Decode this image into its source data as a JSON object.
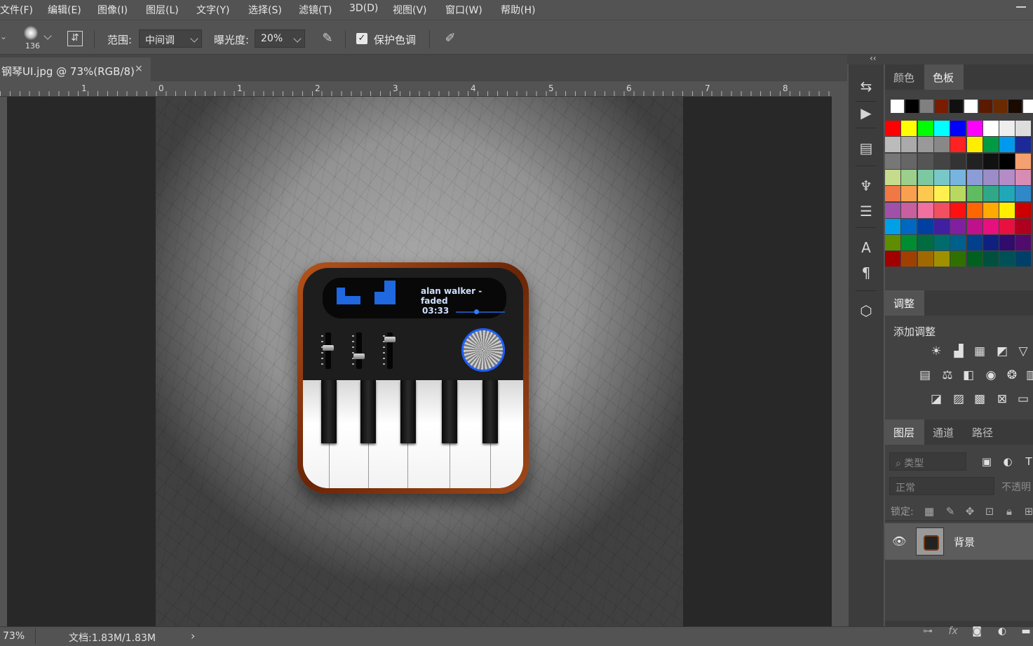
{
  "menu": {
    "items": [
      "文件(F)",
      "编辑(E)",
      "图像(I)",
      "图层(L)",
      "文字(Y)",
      "选择(S)",
      "滤镜(T)",
      "3D(D)",
      "视图(V)",
      "窗口(W)",
      "帮助(H)"
    ]
  },
  "options": {
    "brush_size": "136",
    "range_label": "范围:",
    "range_value": "中间调",
    "exposure_label": "曝光度:",
    "exposure_value": "20%",
    "protect_tones_label": "保护色调",
    "protect_tones_checked": true
  },
  "document": {
    "tab_title": "钢琴UI.jpg @ 73%(RGB/8)",
    "close_glyph": "×"
  },
  "ruler": {
    "labels": [
      "1",
      "0",
      "1",
      "2",
      "3",
      "4",
      "5",
      "6",
      "7",
      "8"
    ]
  },
  "canvas": {
    "track_title": "alan walker - faded",
    "track_time": "03:33"
  },
  "status": {
    "zoom": "73%",
    "doc_size": "文档:1.83M/1.83M",
    "arrow": "›"
  },
  "panels": {
    "collapse_glyph": "‹‹",
    "color_tabs": [
      "颜色",
      "色板"
    ],
    "active_color_tab": "色板",
    "adjustments_tab": "调整",
    "add_adjustment_label": "添加调整",
    "layer_tabs": [
      "图层",
      "通道",
      "路径"
    ],
    "filter_placeholder": "类型",
    "blend_mode": "正常",
    "opacity_label": "不透明",
    "lock_label": "锁定:",
    "layer_name": "背景",
    "footer_icons": [
      "link-icon",
      "fx-icon",
      "mask-icon",
      "adjustment-layer-icon",
      "folder-icon"
    ]
  },
  "swatches": {
    "rows": [
      [
        "#ffffff",
        "#000000",
        "#808080",
        "#7a1c00",
        "#101010",
        "#ffffff",
        "#5a1a00",
        "#6a2a00",
        "#1a0a00",
        "#ffffff"
      ],
      [
        "#ff0000",
        "#ffff00",
        "#00ff00",
        "#00ffff",
        "#0000ff",
        "#ff00ff",
        "#ffffff",
        "#eeeeee",
        "#dddddd"
      ],
      [
        "#bbbbbb",
        "#aaaaaa",
        "#999999",
        "#888888",
        "#ff2222",
        "#ffee00",
        "#009944",
        "#0099ee",
        "#1a2a99"
      ],
      [
        "#777777",
        "#666666",
        "#555555",
        "#444444",
        "#333333",
        "#222222",
        "#111111",
        "#000000",
        "#f4a070"
      ],
      [
        "#c4dc8c",
        "#9ad08c",
        "#7cc8a0",
        "#78c8c8",
        "#78b4e0",
        "#8c9cd8",
        "#9c8cc8",
        "#b48cc8",
        "#d88cb4"
      ],
      [
        "#f07844",
        "#f8a050",
        "#fcc850",
        "#fff050",
        "#b8d860",
        "#60bc60",
        "#30a888",
        "#20a8b8",
        "#3088c8"
      ],
      [
        "#a050a8",
        "#c860a0",
        "#f070a0",
        "#f05060",
        "#ff1010",
        "#ff6600",
        "#ffaa00",
        "#ffee00",
        "#cc0000"
      ],
      [
        "#00a0e8",
        "#0068c0",
        "#0040a0",
        "#4020a0",
        "#8020a0",
        "#c0108c",
        "#e8107c",
        "#e81040",
        "#b00020"
      ],
      [
        "#608c00",
        "#008c30",
        "#006c40",
        "#006c6c",
        "#00608c",
        "#00408c",
        "#102080",
        "#300c6c",
        "#500c6c"
      ],
      [
        "#a00000",
        "#a04000",
        "#a06800",
        "#a09000",
        "#307000",
        "#006020",
        "#005040",
        "#005058",
        "#004068"
      ]
    ]
  },
  "colors": {
    "accent_blue": "#1f68e0",
    "wood": "#8a3a10"
  }
}
